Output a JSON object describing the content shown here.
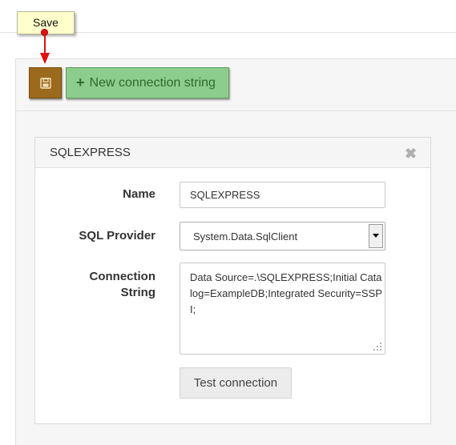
{
  "callout": {
    "label": "Save"
  },
  "toolbar": {
    "save_icon": "floppy-disk-icon",
    "new_connection_label": "New connection string",
    "new_connection_icon": "plus-icon"
  },
  "card": {
    "title": "SQLEXPRESS",
    "close_icon": "close-icon",
    "fields": {
      "name": {
        "label": "Name",
        "value": "SQLEXPRESS"
      },
      "provider": {
        "label": "SQL Provider",
        "value": "System.Data.SqlClient"
      },
      "connection_string": {
        "label_line1": "Connection",
        "label_line2": "String",
        "value": "Data Source=.\\SQLEXPRESS;Initial Catalog=ExampleDB;Integrated Security=SSPI;"
      }
    },
    "test_button_label": "Test connection"
  },
  "colors": {
    "save_button": "#9c6a1c",
    "new_button": "#8ccc8c",
    "callout_background": "#ffffcc",
    "callout_marker": "#e01010"
  }
}
